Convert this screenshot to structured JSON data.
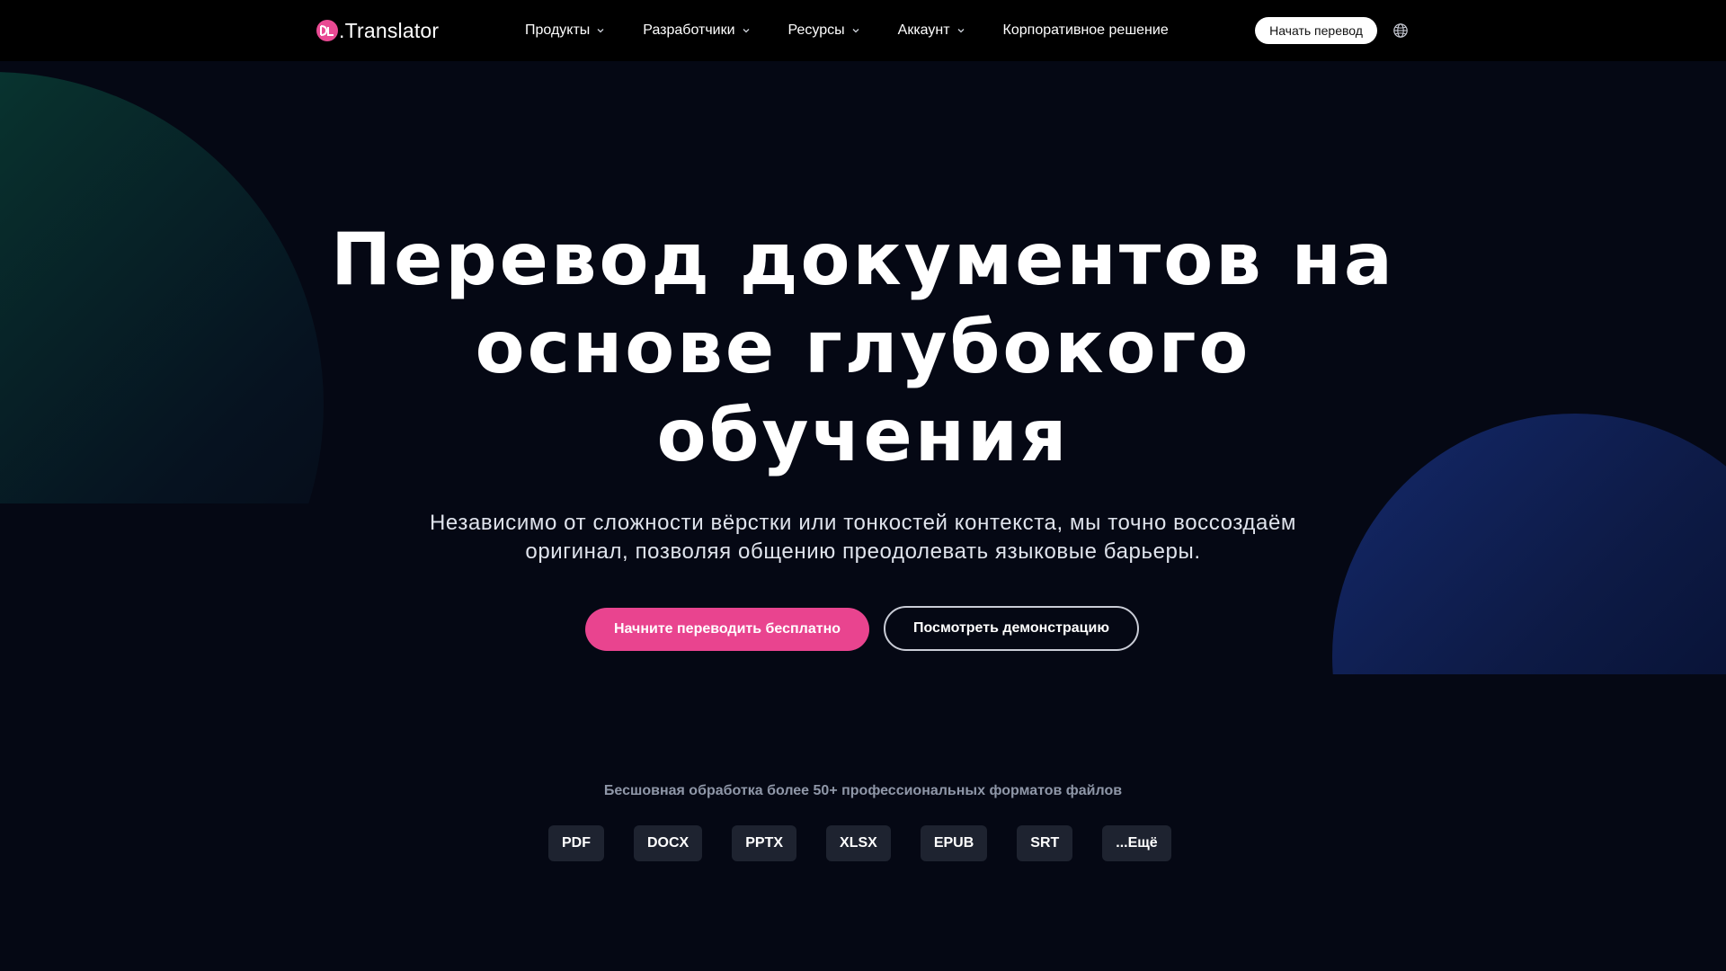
{
  "colors": {
    "background": "#050814",
    "nav_background": "#000000",
    "accent_pink": "#e9448f",
    "chip_background": "#1e2330",
    "caption_gray": "#8f97a8"
  },
  "nav": {
    "logo_icon": "pink-circle-logo-icon",
    "logo_text": ".Translator",
    "menu": [
      {
        "label": "Продукты",
        "icon": "chevron-down-icon"
      },
      {
        "label": "Разработчики",
        "icon": "chevron-down-icon"
      },
      {
        "label": "Ресурсы",
        "icon": "chevron-down-icon"
      },
      {
        "label": "Аккаунт",
        "icon": "chevron-down-icon"
      },
      {
        "label": "Корпоративное решение"
      }
    ],
    "cta_label": "Начать перевод",
    "language_icon": "globe-icon"
  },
  "hero": {
    "title_line1": "Перевод документов на",
    "title_line2": "основе глубокого",
    "title_line3": "обучения",
    "subtitle_line1": "Независимо от сложности вёрстки или тонкостей контекста, мы точно воссоздаём",
    "subtitle_line2": "оригинал, позволяя общению преодолевать языковые барьеры.",
    "primary_button": "Начните переводить бесплатно",
    "secondary_button": "Посмотреть демонстрацию"
  },
  "formats": {
    "caption": "Бесшовная обработка более 50+ профессиональных форматов файлов",
    "items": [
      "PDF",
      "DOCX",
      "PPTX",
      "XLSX",
      "EPUB",
      "SRT",
      "...Ещё"
    ]
  }
}
